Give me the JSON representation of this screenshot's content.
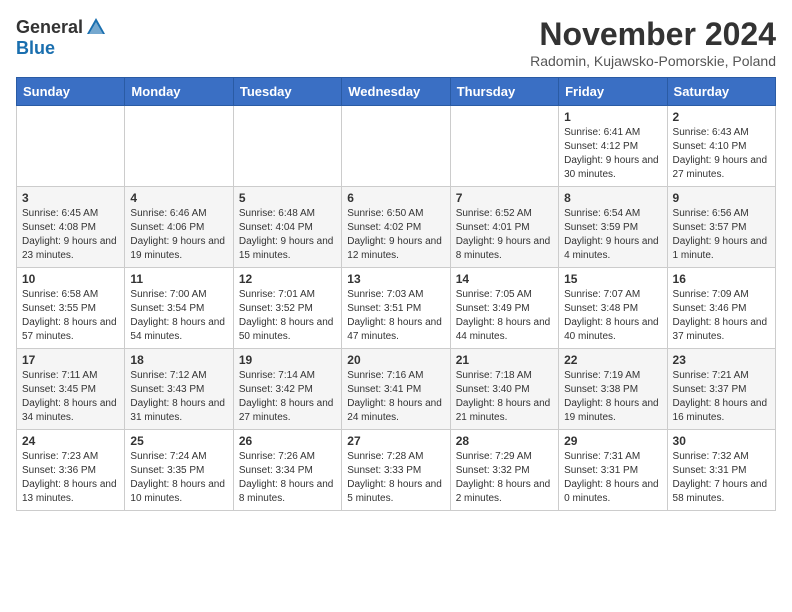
{
  "logo": {
    "general": "General",
    "blue": "Blue"
  },
  "title": "November 2024",
  "subtitle": "Radomin, Kujawsko-Pomorskie, Poland",
  "days_of_week": [
    "Sunday",
    "Monday",
    "Tuesday",
    "Wednesday",
    "Thursday",
    "Friday",
    "Saturday"
  ],
  "weeks": [
    [
      {
        "day": "",
        "info": ""
      },
      {
        "day": "",
        "info": ""
      },
      {
        "day": "",
        "info": ""
      },
      {
        "day": "",
        "info": ""
      },
      {
        "day": "",
        "info": ""
      },
      {
        "day": "1",
        "info": "Sunrise: 6:41 AM\nSunset: 4:12 PM\nDaylight: 9 hours and 30 minutes."
      },
      {
        "day": "2",
        "info": "Sunrise: 6:43 AM\nSunset: 4:10 PM\nDaylight: 9 hours and 27 minutes."
      }
    ],
    [
      {
        "day": "3",
        "info": "Sunrise: 6:45 AM\nSunset: 4:08 PM\nDaylight: 9 hours and 23 minutes."
      },
      {
        "day": "4",
        "info": "Sunrise: 6:46 AM\nSunset: 4:06 PM\nDaylight: 9 hours and 19 minutes."
      },
      {
        "day": "5",
        "info": "Sunrise: 6:48 AM\nSunset: 4:04 PM\nDaylight: 9 hours and 15 minutes."
      },
      {
        "day": "6",
        "info": "Sunrise: 6:50 AM\nSunset: 4:02 PM\nDaylight: 9 hours and 12 minutes."
      },
      {
        "day": "7",
        "info": "Sunrise: 6:52 AM\nSunset: 4:01 PM\nDaylight: 9 hours and 8 minutes."
      },
      {
        "day": "8",
        "info": "Sunrise: 6:54 AM\nSunset: 3:59 PM\nDaylight: 9 hours and 4 minutes."
      },
      {
        "day": "9",
        "info": "Sunrise: 6:56 AM\nSunset: 3:57 PM\nDaylight: 9 hours and 1 minute."
      }
    ],
    [
      {
        "day": "10",
        "info": "Sunrise: 6:58 AM\nSunset: 3:55 PM\nDaylight: 8 hours and 57 minutes."
      },
      {
        "day": "11",
        "info": "Sunrise: 7:00 AM\nSunset: 3:54 PM\nDaylight: 8 hours and 54 minutes."
      },
      {
        "day": "12",
        "info": "Sunrise: 7:01 AM\nSunset: 3:52 PM\nDaylight: 8 hours and 50 minutes."
      },
      {
        "day": "13",
        "info": "Sunrise: 7:03 AM\nSunset: 3:51 PM\nDaylight: 8 hours and 47 minutes."
      },
      {
        "day": "14",
        "info": "Sunrise: 7:05 AM\nSunset: 3:49 PM\nDaylight: 8 hours and 44 minutes."
      },
      {
        "day": "15",
        "info": "Sunrise: 7:07 AM\nSunset: 3:48 PM\nDaylight: 8 hours and 40 minutes."
      },
      {
        "day": "16",
        "info": "Sunrise: 7:09 AM\nSunset: 3:46 PM\nDaylight: 8 hours and 37 minutes."
      }
    ],
    [
      {
        "day": "17",
        "info": "Sunrise: 7:11 AM\nSunset: 3:45 PM\nDaylight: 8 hours and 34 minutes."
      },
      {
        "day": "18",
        "info": "Sunrise: 7:12 AM\nSunset: 3:43 PM\nDaylight: 8 hours and 31 minutes."
      },
      {
        "day": "19",
        "info": "Sunrise: 7:14 AM\nSunset: 3:42 PM\nDaylight: 8 hours and 27 minutes."
      },
      {
        "day": "20",
        "info": "Sunrise: 7:16 AM\nSunset: 3:41 PM\nDaylight: 8 hours and 24 minutes."
      },
      {
        "day": "21",
        "info": "Sunrise: 7:18 AM\nSunset: 3:40 PM\nDaylight: 8 hours and 21 minutes."
      },
      {
        "day": "22",
        "info": "Sunrise: 7:19 AM\nSunset: 3:38 PM\nDaylight: 8 hours and 19 minutes."
      },
      {
        "day": "23",
        "info": "Sunrise: 7:21 AM\nSunset: 3:37 PM\nDaylight: 8 hours and 16 minutes."
      }
    ],
    [
      {
        "day": "24",
        "info": "Sunrise: 7:23 AM\nSunset: 3:36 PM\nDaylight: 8 hours and 13 minutes."
      },
      {
        "day": "25",
        "info": "Sunrise: 7:24 AM\nSunset: 3:35 PM\nDaylight: 8 hours and 10 minutes."
      },
      {
        "day": "26",
        "info": "Sunrise: 7:26 AM\nSunset: 3:34 PM\nDaylight: 8 hours and 8 minutes."
      },
      {
        "day": "27",
        "info": "Sunrise: 7:28 AM\nSunset: 3:33 PM\nDaylight: 8 hours and 5 minutes."
      },
      {
        "day": "28",
        "info": "Sunrise: 7:29 AM\nSunset: 3:32 PM\nDaylight: 8 hours and 2 minutes."
      },
      {
        "day": "29",
        "info": "Sunrise: 7:31 AM\nSunset: 3:31 PM\nDaylight: 8 hours and 0 minutes."
      },
      {
        "day": "30",
        "info": "Sunrise: 7:32 AM\nSunset: 3:31 PM\nDaylight: 7 hours and 58 minutes."
      }
    ]
  ]
}
